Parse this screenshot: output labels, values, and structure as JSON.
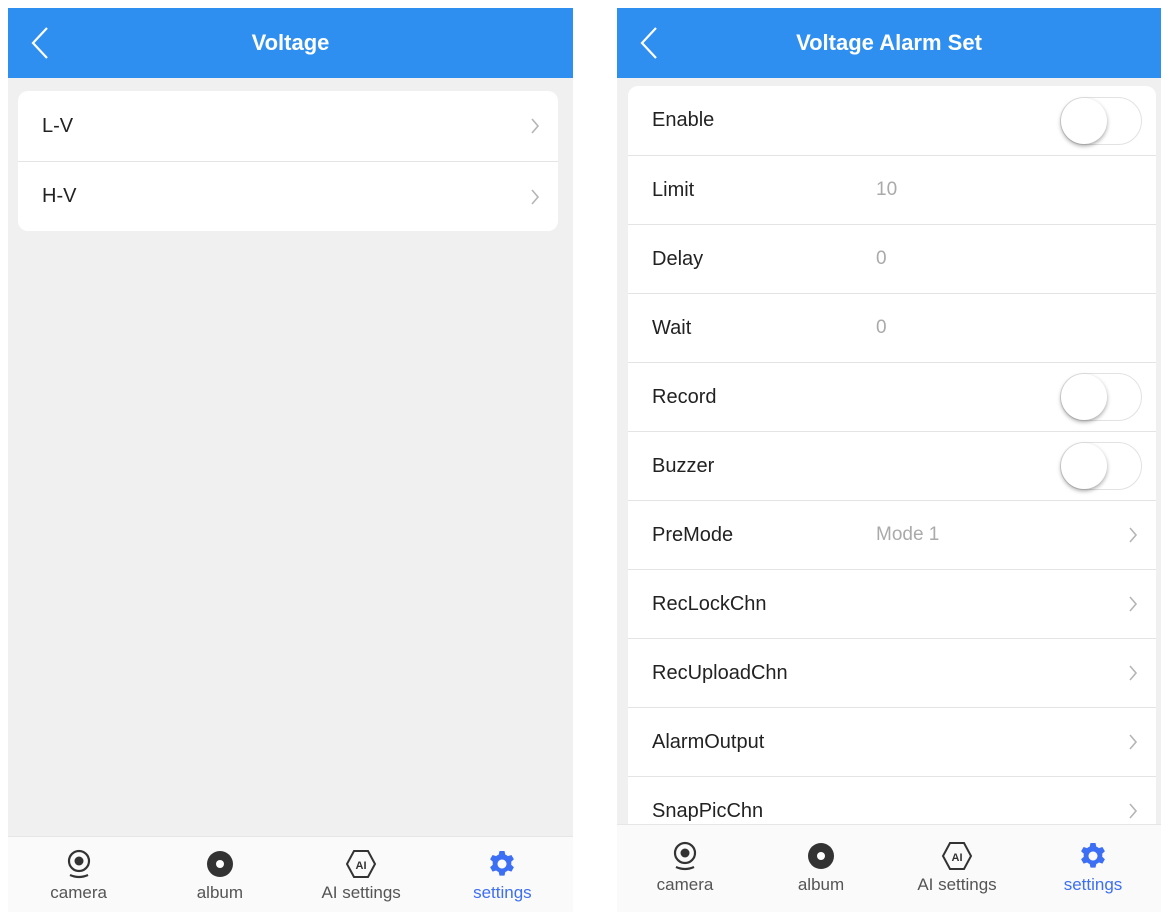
{
  "colors": {
    "header": "#2f8ff0",
    "active_tab": "#3d6ff5",
    "inactive_tab": "#555555",
    "background": "#f0f0f0"
  },
  "left_screen": {
    "title": "Voltage",
    "back_icon": "chevron-left-icon",
    "items": [
      {
        "label": "L-V",
        "icon": "chevron-right-icon"
      },
      {
        "label": "H-V",
        "icon": "chevron-right-icon"
      }
    ],
    "tabs": [
      {
        "label": "camera",
        "icon": "camera-icon",
        "active": false
      },
      {
        "label": "album",
        "icon": "album-icon",
        "active": false
      },
      {
        "label": "AI settings",
        "icon": "ai-icon",
        "active": false
      },
      {
        "label": "settings",
        "icon": "gear-icon",
        "active": true
      }
    ]
  },
  "right_screen": {
    "title": "Voltage Alarm Set",
    "back_icon": "chevron-left-icon",
    "rows": [
      {
        "label": "Enable",
        "type": "toggle",
        "on": false
      },
      {
        "label": "Limit",
        "type": "value",
        "value": "10"
      },
      {
        "label": "Delay",
        "type": "value",
        "value": "0"
      },
      {
        "label": "Wait",
        "type": "value",
        "value": "0"
      },
      {
        "label": "Record",
        "type": "toggle",
        "on": false
      },
      {
        "label": "Buzzer",
        "type": "toggle",
        "on": false
      },
      {
        "label": "PreMode",
        "type": "select",
        "value": "Mode 1"
      },
      {
        "label": "RecLockChn",
        "type": "nav"
      },
      {
        "label": "RecUploadChn",
        "type": "nav"
      },
      {
        "label": "AlarmOutput",
        "type": "nav"
      },
      {
        "label": "SnapPicChn",
        "type": "nav"
      }
    ],
    "tabs": [
      {
        "label": "camera",
        "icon": "camera-icon",
        "active": false
      },
      {
        "label": "album",
        "icon": "album-icon",
        "active": false
      },
      {
        "label": "AI settings",
        "icon": "ai-icon",
        "active": false
      },
      {
        "label": "settings",
        "icon": "gear-icon",
        "active": true
      }
    ]
  }
}
